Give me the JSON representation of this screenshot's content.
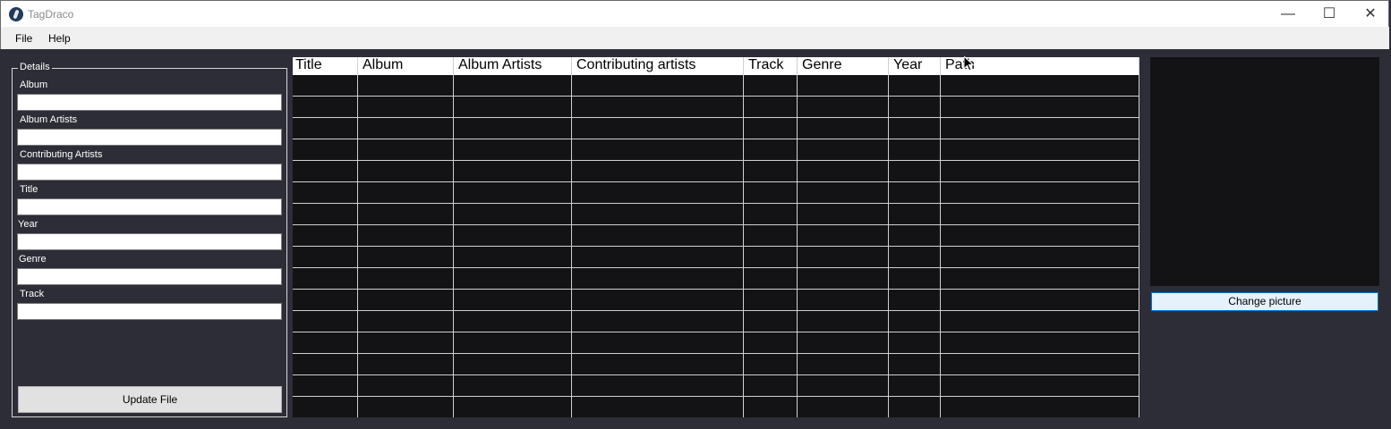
{
  "window": {
    "title": "TagDraco",
    "controls": {
      "minimize": "—",
      "maximize": "☐",
      "close": "✕"
    }
  },
  "menu": {
    "items": [
      "File",
      "Help"
    ]
  },
  "details": {
    "legend": "Details",
    "fields": [
      {
        "label": "Album",
        "value": ""
      },
      {
        "label": "Album Artists",
        "value": ""
      },
      {
        "label": "Contributing Artists",
        "value": ""
      },
      {
        "label": "Title",
        "value": ""
      },
      {
        "label": "Year",
        "value": ""
      },
      {
        "label": "Genre",
        "value": ""
      },
      {
        "label": "Track",
        "value": ""
      }
    ],
    "update_button": "Update File"
  },
  "grid": {
    "columns": [
      "Title",
      "Album",
      "Album Artists",
      "Contributing artists",
      "Track",
      "Genre",
      "Year",
      "Path"
    ],
    "rows": []
  },
  "picture": {
    "change_button": "Change picture"
  },
  "colors": {
    "background": "#2d2d37",
    "grid": "#131316",
    "accent": "#0078d7"
  }
}
